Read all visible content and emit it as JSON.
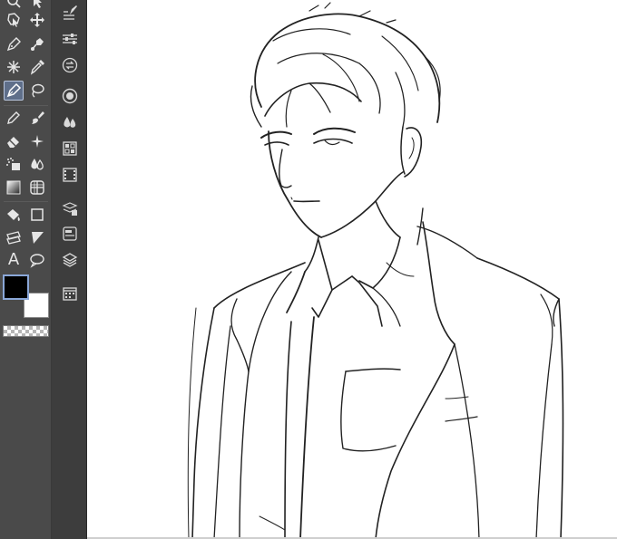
{
  "app": {
    "accent_color": "#8aa7d8",
    "panel_color": "#4a4a4a"
  },
  "toolbox": {
    "selected_tool": "pen-tool",
    "tools": [
      {
        "name": "zoom-tool",
        "icon": "magnifier-icon"
      },
      {
        "name": "operation-tool",
        "icon": "cursor-icon"
      },
      {
        "name": "object-tool",
        "icon": "object-select-icon"
      },
      {
        "name": "move-tool",
        "icon": "move-arrows-icon"
      },
      {
        "name": "pen-tool",
        "icon": "pen-nib-icon"
      },
      {
        "name": "auto-select-tool",
        "icon": "wand-icon"
      },
      {
        "name": "eyedropper-tool",
        "icon": "eyedropper-icon"
      },
      {
        "name": "vector-pen-tool",
        "icon": "vector-pen-icon"
      },
      {
        "name": "lasso-tool",
        "icon": "lasso-icon"
      },
      {
        "name": "pencil-tool",
        "icon": "pencil-icon"
      },
      {
        "name": "brush-tool",
        "icon": "brush-icon"
      },
      {
        "name": "eraser-tool",
        "icon": "eraser-icon"
      },
      {
        "name": "decoration-tool",
        "icon": "sparkle-icon"
      },
      {
        "name": "airbrush-tool",
        "icon": "airbrush-icon"
      },
      {
        "name": "blend-tool",
        "icon": "drops-icon"
      },
      {
        "name": "gradient-tool",
        "icon": "gradient-icon"
      },
      {
        "name": "grid-tool",
        "icon": "grid-icon"
      },
      {
        "name": "fill-tool",
        "icon": "bucket-icon"
      },
      {
        "name": "figure-tool",
        "icon": "square-icon"
      },
      {
        "name": "frame-tool",
        "icon": "frame-icon"
      },
      {
        "name": "ruler-tool",
        "icon": "ruler-icon"
      },
      {
        "name": "text-tool",
        "icon": "text-icon",
        "label": "A"
      },
      {
        "name": "balloon-tool",
        "icon": "speech-bubble-icon"
      }
    ],
    "main_color": "#000000",
    "sub_color": "#ffffff"
  },
  "command_bar": {
    "items": [
      {
        "name": "tool-property-button",
        "icon": "pen-list-icon"
      },
      {
        "name": "sub-tool-detail-button",
        "icon": "sliders-icon"
      },
      {
        "name": "navigator-button",
        "icon": "swap-circle-icon"
      },
      {
        "name": "color-wheel-button",
        "icon": "color-circle-icon"
      },
      {
        "name": "color-set-button",
        "icon": "drops-icon"
      },
      {
        "name": "intermediate-color-button",
        "icon": "palette-grid-icon"
      },
      {
        "name": "animation-button",
        "icon": "filmstrip-icon"
      },
      {
        "name": "material-button",
        "icon": "stack-grid-icon"
      },
      {
        "name": "layer-property-button",
        "icon": "layer-panel-icon"
      },
      {
        "name": "layer-button",
        "icon": "layers-icon"
      },
      {
        "name": "calendar-button",
        "icon": "calendar-icon"
      }
    ]
  },
  "canvas": {
    "background": "#ffffff",
    "content": "line-art-sketch"
  }
}
